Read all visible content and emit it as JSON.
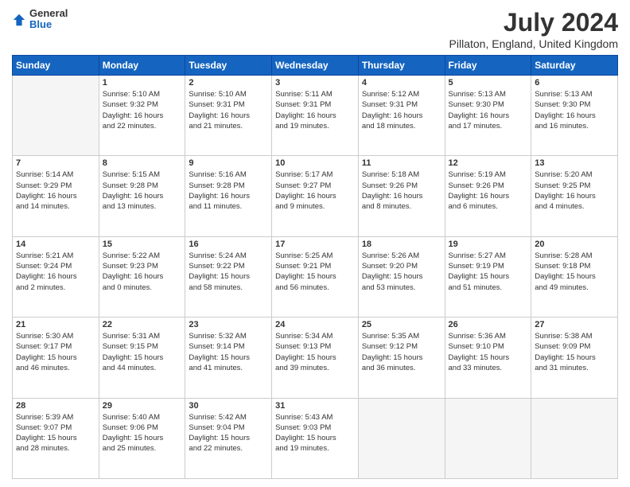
{
  "header": {
    "logo_general": "General",
    "logo_blue": "Blue",
    "month_title": "July 2024",
    "subtitle": "Pillaton, England, United Kingdom"
  },
  "days_of_week": [
    "Sunday",
    "Monday",
    "Tuesday",
    "Wednesday",
    "Thursday",
    "Friday",
    "Saturday"
  ],
  "weeks": [
    [
      {
        "day": "",
        "empty": true,
        "content": ""
      },
      {
        "day": "1",
        "content": "Sunrise: 5:10 AM\nSunset: 9:32 PM\nDaylight: 16 hours\nand 22 minutes."
      },
      {
        "day": "2",
        "content": "Sunrise: 5:10 AM\nSunset: 9:31 PM\nDaylight: 16 hours\nand 21 minutes."
      },
      {
        "day": "3",
        "content": "Sunrise: 5:11 AM\nSunset: 9:31 PM\nDaylight: 16 hours\nand 19 minutes."
      },
      {
        "day": "4",
        "content": "Sunrise: 5:12 AM\nSunset: 9:31 PM\nDaylight: 16 hours\nand 18 minutes."
      },
      {
        "day": "5",
        "content": "Sunrise: 5:13 AM\nSunset: 9:30 PM\nDaylight: 16 hours\nand 17 minutes."
      },
      {
        "day": "6",
        "content": "Sunrise: 5:13 AM\nSunset: 9:30 PM\nDaylight: 16 hours\nand 16 minutes."
      }
    ],
    [
      {
        "day": "7",
        "content": "Sunrise: 5:14 AM\nSunset: 9:29 PM\nDaylight: 16 hours\nand 14 minutes."
      },
      {
        "day": "8",
        "content": "Sunrise: 5:15 AM\nSunset: 9:28 PM\nDaylight: 16 hours\nand 13 minutes."
      },
      {
        "day": "9",
        "content": "Sunrise: 5:16 AM\nSunset: 9:28 PM\nDaylight: 16 hours\nand 11 minutes."
      },
      {
        "day": "10",
        "content": "Sunrise: 5:17 AM\nSunset: 9:27 PM\nDaylight: 16 hours\nand 9 minutes."
      },
      {
        "day": "11",
        "content": "Sunrise: 5:18 AM\nSunset: 9:26 PM\nDaylight: 16 hours\nand 8 minutes."
      },
      {
        "day": "12",
        "content": "Sunrise: 5:19 AM\nSunset: 9:26 PM\nDaylight: 16 hours\nand 6 minutes."
      },
      {
        "day": "13",
        "content": "Sunrise: 5:20 AM\nSunset: 9:25 PM\nDaylight: 16 hours\nand 4 minutes."
      }
    ],
    [
      {
        "day": "14",
        "content": "Sunrise: 5:21 AM\nSunset: 9:24 PM\nDaylight: 16 hours\nand 2 minutes."
      },
      {
        "day": "15",
        "content": "Sunrise: 5:22 AM\nSunset: 9:23 PM\nDaylight: 16 hours\nand 0 minutes."
      },
      {
        "day": "16",
        "content": "Sunrise: 5:24 AM\nSunset: 9:22 PM\nDaylight: 15 hours\nand 58 minutes."
      },
      {
        "day": "17",
        "content": "Sunrise: 5:25 AM\nSunset: 9:21 PM\nDaylight: 15 hours\nand 56 minutes."
      },
      {
        "day": "18",
        "content": "Sunrise: 5:26 AM\nSunset: 9:20 PM\nDaylight: 15 hours\nand 53 minutes."
      },
      {
        "day": "19",
        "content": "Sunrise: 5:27 AM\nSunset: 9:19 PM\nDaylight: 15 hours\nand 51 minutes."
      },
      {
        "day": "20",
        "content": "Sunrise: 5:28 AM\nSunset: 9:18 PM\nDaylight: 15 hours\nand 49 minutes."
      }
    ],
    [
      {
        "day": "21",
        "content": "Sunrise: 5:30 AM\nSunset: 9:17 PM\nDaylight: 15 hours\nand 46 minutes."
      },
      {
        "day": "22",
        "content": "Sunrise: 5:31 AM\nSunset: 9:15 PM\nDaylight: 15 hours\nand 44 minutes."
      },
      {
        "day": "23",
        "content": "Sunrise: 5:32 AM\nSunset: 9:14 PM\nDaylight: 15 hours\nand 41 minutes."
      },
      {
        "day": "24",
        "content": "Sunrise: 5:34 AM\nSunset: 9:13 PM\nDaylight: 15 hours\nand 39 minutes."
      },
      {
        "day": "25",
        "content": "Sunrise: 5:35 AM\nSunset: 9:12 PM\nDaylight: 15 hours\nand 36 minutes."
      },
      {
        "day": "26",
        "content": "Sunrise: 5:36 AM\nSunset: 9:10 PM\nDaylight: 15 hours\nand 33 minutes."
      },
      {
        "day": "27",
        "content": "Sunrise: 5:38 AM\nSunset: 9:09 PM\nDaylight: 15 hours\nand 31 minutes."
      }
    ],
    [
      {
        "day": "28",
        "content": "Sunrise: 5:39 AM\nSunset: 9:07 PM\nDaylight: 15 hours\nand 28 minutes."
      },
      {
        "day": "29",
        "content": "Sunrise: 5:40 AM\nSunset: 9:06 PM\nDaylight: 15 hours\nand 25 minutes."
      },
      {
        "day": "30",
        "content": "Sunrise: 5:42 AM\nSunset: 9:04 PM\nDaylight: 15 hours\nand 22 minutes."
      },
      {
        "day": "31",
        "content": "Sunrise: 5:43 AM\nSunset: 9:03 PM\nDaylight: 15 hours\nand 19 minutes."
      },
      {
        "day": "",
        "empty": true,
        "content": ""
      },
      {
        "day": "",
        "empty": true,
        "content": ""
      },
      {
        "day": "",
        "empty": true,
        "content": ""
      }
    ]
  ]
}
